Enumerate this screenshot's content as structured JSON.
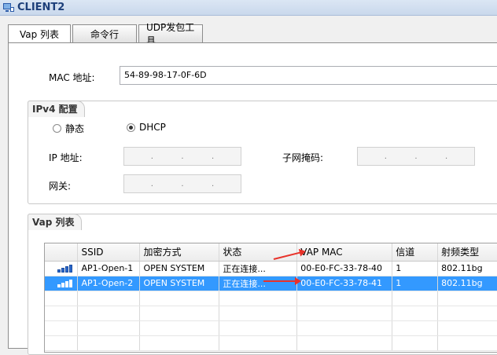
{
  "window": {
    "title": "CLIENT2"
  },
  "tabs": [
    {
      "label": "Vap 列表",
      "active": true
    },
    {
      "label": "命令行",
      "active": false
    },
    {
      "label": "UDP发包工具",
      "active": false
    }
  ],
  "mac": {
    "label": "MAC 地址:",
    "value": "54-89-98-17-0F-6D"
  },
  "ipv4": {
    "title": "IPv4 配置",
    "static_label": "静态",
    "dhcp_label": "DHCP",
    "selected": "DHCP",
    "ip_label": "IP 地址:",
    "mask_label": "子网掩码:",
    "gateway_label": "网关:",
    "dot": "."
  },
  "vap": {
    "title": "Vap 列表",
    "columns": [
      "",
      "SSID",
      "加密方式",
      "状态",
      "VAP MAC",
      "信道",
      "射频类型"
    ],
    "rows": [
      {
        "ssid": "AP1-Open-1",
        "encryption": "OPEN SYSTEM",
        "status": "正在连接...",
        "vap_mac": "00-E0-FC-33-78-40",
        "channel": "1",
        "radio": "802.11bg",
        "selected": false
      },
      {
        "ssid": "AP1-Open-2",
        "encryption": "OPEN SYSTEM",
        "status": "正在连接...",
        "vap_mac": "00-E0-FC-33-78-41",
        "channel": "1",
        "radio": "802.11bg",
        "selected": true
      }
    ]
  },
  "colors": {
    "selection": "#3399ff",
    "arrow": "#e8322a",
    "signal": "#2a66c8"
  }
}
